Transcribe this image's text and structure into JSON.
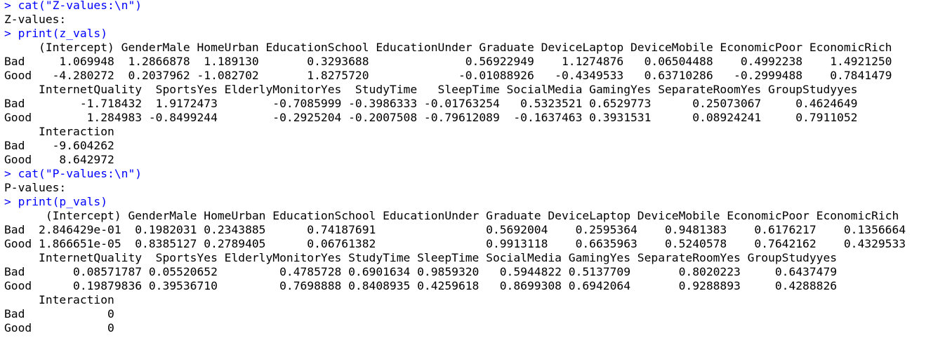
{
  "colors": {
    "command": "#0000ff",
    "output": "#000000",
    "background": "#ffffff"
  },
  "console_lines": [
    {
      "kind": "command",
      "text": "> cat(\"Z-values:\\n\")"
    },
    {
      "kind": "output",
      "text": "Z-values:"
    },
    {
      "kind": "command",
      "text": "> print(z_vals)"
    },
    {
      "kind": "output",
      "text": "     (Intercept) GenderMale HomeUrban EducationSchool EducationUnder Graduate DeviceLaptop DeviceMobile EconomicPoor EconomicRich"
    },
    {
      "kind": "output",
      "text": "Bad     1.069948  1.2866878  1.189130       0.3293688              0.56922949    1.1274876   0.06504488    0.4992238    1.4921250"
    },
    {
      "kind": "output",
      "text": "Good   -4.280272  0.2037962 -1.082702       1.8275720             -0.01088926   -0.4349533   0.63710286   -0.2999488    0.7841479"
    },
    {
      "kind": "output",
      "text": "     InternetQuality  SportsYes ElderlyMonitorYes  StudyTime   SleepTime SocialMedia GamingYes SeparateRoomYes GroupStudyyes"
    },
    {
      "kind": "output",
      "text": "Bad        -1.718432  1.9172473        -0.7085999 -0.3986333 -0.01763254   0.5323521 0.6529773      0.25073067     0.4624649"
    },
    {
      "kind": "output",
      "text": "Good        1.284983 -0.8499244        -0.2925204 -0.2007508 -0.79612089  -0.1637463 0.3931531      0.08924241     0.7911052"
    },
    {
      "kind": "output",
      "text": "     Interaction"
    },
    {
      "kind": "output",
      "text": "Bad    -9.604262"
    },
    {
      "kind": "output",
      "text": "Good    8.642972"
    },
    {
      "kind": "command",
      "text": "> cat(\"P-values:\\n\")"
    },
    {
      "kind": "output",
      "text": "P-values:"
    },
    {
      "kind": "command",
      "text": "> print(p_vals)"
    },
    {
      "kind": "output",
      "text": "      (Intercept) GenderMale HomeUrban EducationSchool EducationUnder Graduate DeviceLaptop DeviceMobile EconomicPoor EconomicRich"
    },
    {
      "kind": "output",
      "text": "Bad  2.846429e-01  0.1982031 0.2343885      0.74187691                0.5692004    0.2595364    0.9481383    0.6176217    0.1356664"
    },
    {
      "kind": "output",
      "text": "Good 1.866651e-05  0.8385127 0.2789405      0.06761382                0.9913118    0.6635963    0.5240578    0.7642162    0.4329533"
    },
    {
      "kind": "output",
      "text": "     InternetQuality  SportsYes ElderlyMonitorYes StudyTime SleepTime SocialMedia GamingYes SeparateRoomYes GroupStudyyes"
    },
    {
      "kind": "output",
      "text": "Bad       0.08571787 0.05520652         0.4785728 0.6901634 0.9859320   0.5944822 0.5137709       0.8020223     0.6437479"
    },
    {
      "kind": "output",
      "text": "Good      0.19879836 0.39536710         0.7698888 0.8408935 0.4259618   0.8699308 0.6942064       0.9288893     0.4288826"
    },
    {
      "kind": "output",
      "text": "     Interaction"
    },
    {
      "kind": "output",
      "text": "Bad            0"
    },
    {
      "kind": "output",
      "text": "Good           0"
    }
  ]
}
